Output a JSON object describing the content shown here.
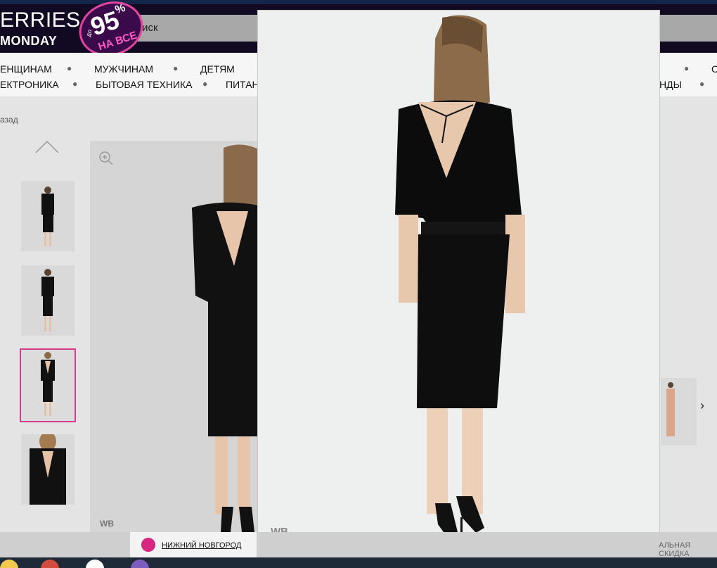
{
  "header": {
    "brand_line1": "ERRIES",
    "brand_line2": "MONDAY",
    "promo_upto": "до",
    "promo_percent": "95",
    "promo_onall": "НА ВСЕ",
    "search_placeholder": "Поиск"
  },
  "nav": {
    "row1": [
      "ЕНЩИНАМ",
      "МУЖЧИНАМ",
      "ДЕТЯМ"
    ],
    "row2": [
      "ЕКТРОНИКА",
      "БЫТОВАЯ ТЕХНИКА",
      "ПИТАН"
    ],
    "row2_right": "НДЫ",
    "row1_right": "С"
  },
  "breadcrumb": {
    "back_label": "азад"
  },
  "gallery": {
    "watermark": "WB",
    "overlay_watermark": "WB"
  },
  "bottom": {
    "city": "НИЖНИЙ НОВГОРОД",
    "discount": "АЛЬНАЯ СКИДКА"
  },
  "colors": {
    "accent": "#d43b8b",
    "header_bg": "#120a22",
    "search_bg": "#a8a8a8"
  }
}
